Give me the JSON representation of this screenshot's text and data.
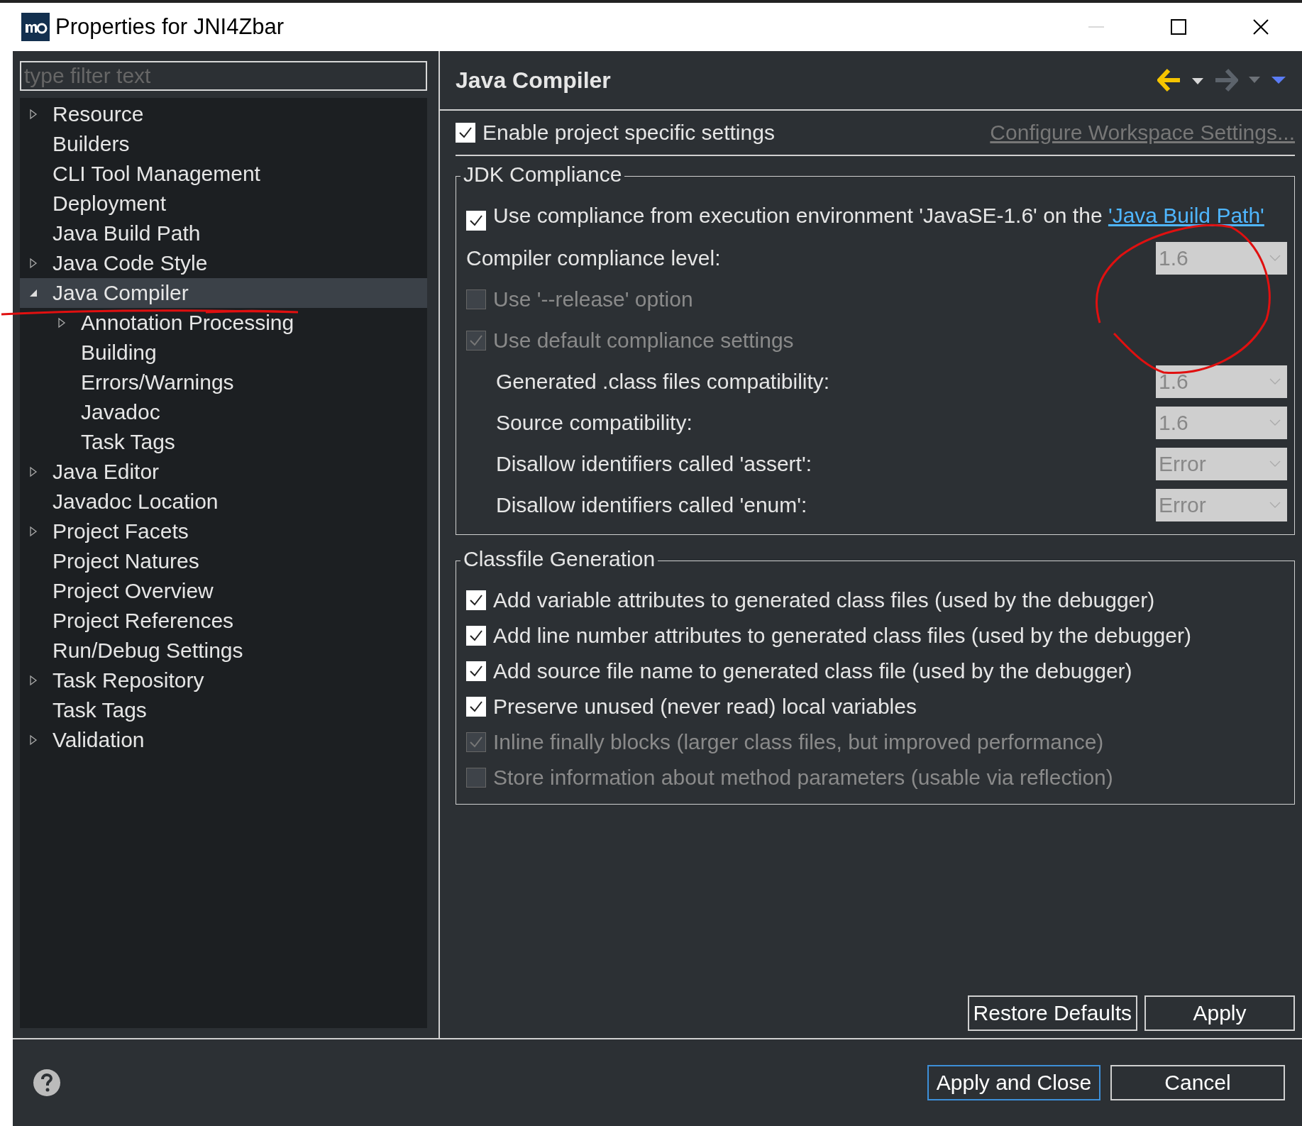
{
  "window": {
    "title": "Properties for JNI4Zbar"
  },
  "filter": {
    "placeholder": "type filter text"
  },
  "tree": [
    {
      "label": "Resource",
      "expanded": false,
      "selected": false
    },
    {
      "label": "Builders",
      "selected": false
    },
    {
      "label": "CLI Tool Management",
      "selected": false
    },
    {
      "label": "Deployment",
      "selected": false
    },
    {
      "label": "Java Build Path",
      "selected": false
    },
    {
      "label": "Java Code Style",
      "expanded": false,
      "selected": false
    },
    {
      "label": "Java Compiler",
      "expanded": true,
      "selected": true,
      "children": [
        {
          "label": "Annotation Processing",
          "expanded": false,
          "selected": false
        },
        {
          "label": "Building",
          "selected": false
        },
        {
          "label": "Errors/Warnings",
          "selected": false
        },
        {
          "label": "Javadoc",
          "selected": false
        },
        {
          "label": "Task Tags",
          "selected": false
        }
      ]
    },
    {
      "label": "Java Editor",
      "expanded": false,
      "selected": false
    },
    {
      "label": "Javadoc Location",
      "selected": false
    },
    {
      "label": "Project Facets",
      "expanded": false,
      "selected": false
    },
    {
      "label": "Project Natures",
      "selected": false
    },
    {
      "label": "Project Overview",
      "selected": false
    },
    {
      "label": "Project References",
      "selected": false
    },
    {
      "label": "Run/Debug Settings",
      "selected": false
    },
    {
      "label": "Task Repository",
      "expanded": false,
      "selected": false
    },
    {
      "label": "Task Tags",
      "selected": false
    },
    {
      "label": "Validation",
      "expanded": false,
      "selected": false
    }
  ],
  "page": {
    "title": "Java Compiler",
    "project_specific": {
      "label": "Enable project specific settings",
      "checked": true
    },
    "configure_link": "Configure Workspace Settings...",
    "jdk_compliance": {
      "title": "JDK Compliance",
      "use_compliance": {
        "label": "Use compliance from execution environment 'JavaSE-1.6' on the",
        "link": "'Java Build Path'",
        "checked": true
      },
      "rows": [
        {
          "kind": "select",
          "label": "Compiler compliance level:",
          "value": "1.6",
          "disabled": true
        },
        {
          "kind": "checkbox",
          "label": "Use '--release' option",
          "checked": false,
          "disabled": true
        },
        {
          "kind": "checkbox",
          "label": "Use default compliance settings",
          "checked": true,
          "disabled": true,
          "children": [
            {
              "kind": "select",
              "label": "Generated .class files compatibility:",
              "value": "1.6",
              "disabled": true
            },
            {
              "kind": "select",
              "label": "Source compatibility:",
              "value": "1.6",
              "disabled": true
            },
            {
              "kind": "select",
              "label": "Disallow identifiers called 'assert':",
              "value": "Error",
              "disabled": true
            },
            {
              "kind": "select",
              "label": "Disallow identifiers called 'enum':",
              "value": "Error",
              "disabled": true
            }
          ]
        }
      ]
    },
    "classfile": {
      "title": "Classfile Generation",
      "options": [
        {
          "label": "Add variable attributes to generated class files (used by the debugger)",
          "checked": true,
          "disabled": false
        },
        {
          "label": "Add line number attributes to generated class files (used by the debugger)",
          "checked": true,
          "disabled": false
        },
        {
          "label": "Add source file name to generated class file (used by the debugger)",
          "checked": true,
          "disabled": false
        },
        {
          "label": "Preserve unused (never read) local variables",
          "checked": true,
          "disabled": false
        },
        {
          "label": "Inline finally blocks (larger class files, but improved performance)",
          "checked": true,
          "disabled": true
        },
        {
          "label": "Store information about method parameters (usable via reflection)",
          "checked": false,
          "disabled": true
        }
      ]
    },
    "buttons": [
      {
        "label": "Restore Defaults"
      },
      {
        "label": "Apply"
      }
    ]
  },
  "footer": {
    "buttons": [
      {
        "label": "Apply and Close",
        "default": true
      },
      {
        "label": "Cancel",
        "default": false
      }
    ]
  }
}
